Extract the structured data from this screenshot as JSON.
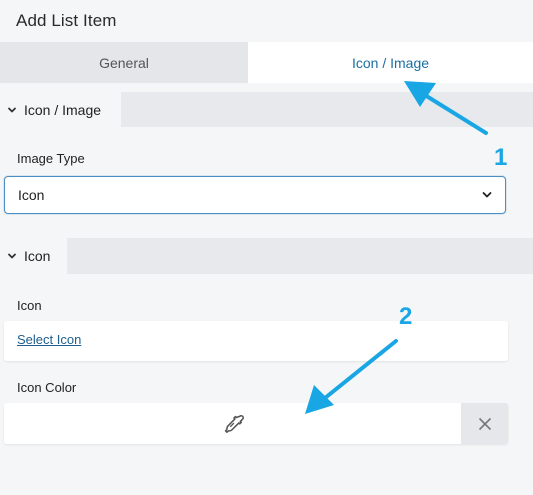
{
  "header": {
    "title": "Add List Item"
  },
  "tabs": [
    {
      "label": "General",
      "active": false
    },
    {
      "label": "Icon / Image",
      "active": true
    }
  ],
  "sections": {
    "icon_image": {
      "label": "Icon / Image",
      "image_type_label": "Image Type",
      "image_type_value": "Icon"
    },
    "icon": {
      "label": "Icon",
      "icon_label": "Icon",
      "select_icon_link": "Select Icon",
      "icon_color_label": "Icon Color"
    }
  },
  "annotations": [
    {
      "number": "1"
    },
    {
      "number": "2"
    }
  ],
  "colors": {
    "accent": "#19a6e4",
    "active_tab_text": "#1a6fa3",
    "focus_border": "#4c8fc4"
  },
  "icons": [
    "chevron-down-icon",
    "eyedropper-icon",
    "close-icon",
    "arrow-icon"
  ]
}
